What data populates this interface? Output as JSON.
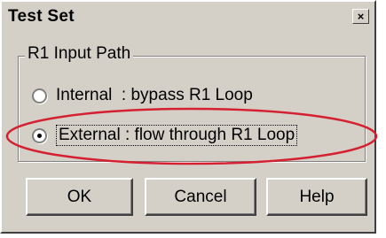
{
  "dialog": {
    "title": "Test Set",
    "close_glyph": "×",
    "group": {
      "label": "R1 Input Path",
      "options": [
        {
          "label": "Internal  : bypass R1 Loop",
          "selected": false
        },
        {
          "label": "External : flow through R1 Loop",
          "selected": true
        }
      ]
    },
    "buttons": {
      "ok": "OK",
      "cancel": "Cancel",
      "help": "Help"
    }
  },
  "colors": {
    "dialog_bg": "#d4d0c8",
    "highlight_ellipse": "#d42030"
  },
  "icons": {
    "close": "close-icon"
  }
}
